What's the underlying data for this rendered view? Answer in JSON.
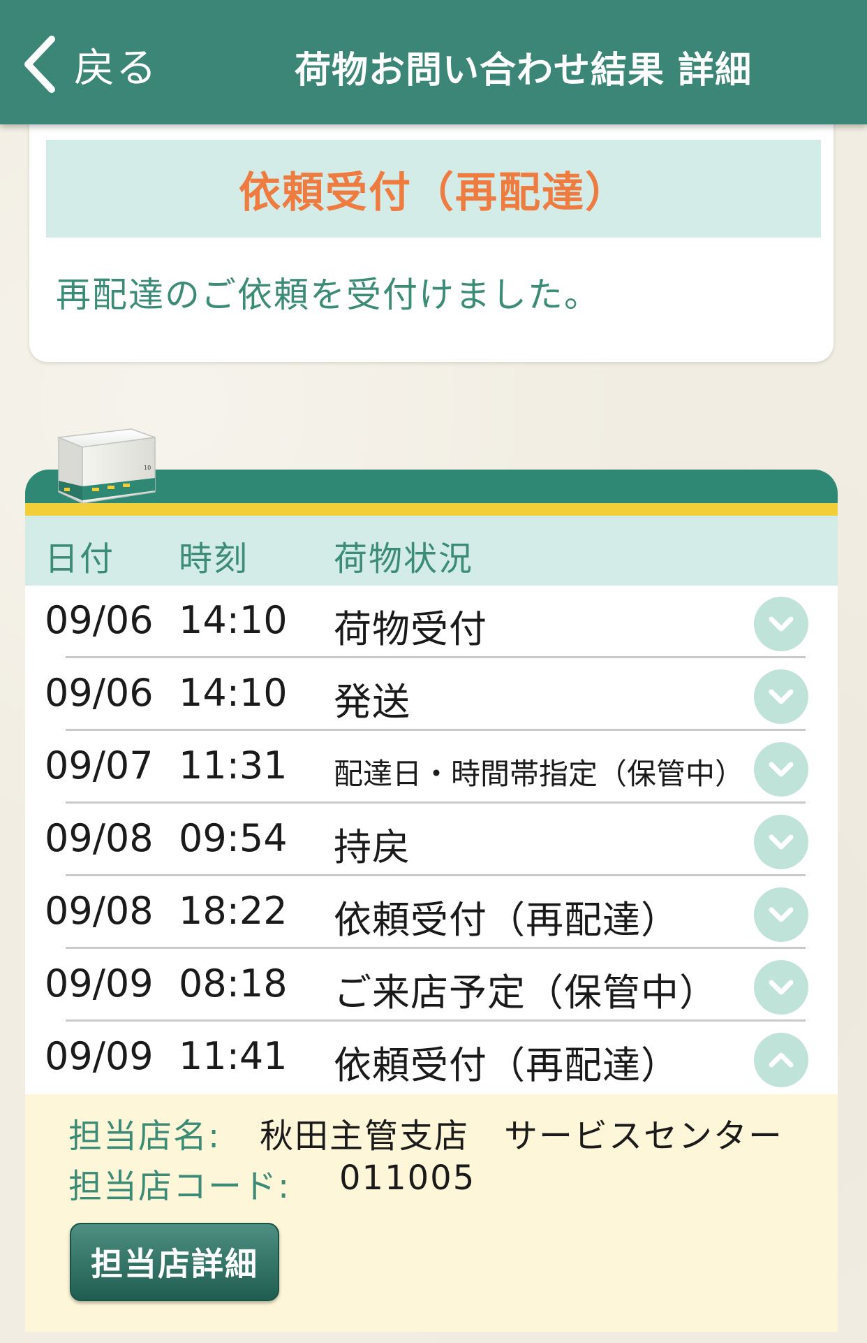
{
  "header": {
    "back_label": "戻る",
    "title": "荷物お問い合わせ結果 詳細"
  },
  "status_card": {
    "title": "依頼受付（再配達）",
    "message": "再配達のご依頼を受付けました。"
  },
  "tracking": {
    "columns": {
      "date": "日付",
      "time": "時刻",
      "status": "荷物状況"
    },
    "rows": [
      {
        "date": "09/06",
        "time": "14:10",
        "status": "荷物受付",
        "expanded": false
      },
      {
        "date": "09/06",
        "time": "14:10",
        "status": "発送",
        "expanded": false
      },
      {
        "date": "09/07",
        "time": "11:31",
        "status": "配達日・時間帯指定（保管中）",
        "expanded": false
      },
      {
        "date": "09/08",
        "time": "09:54",
        "status": "持戻",
        "expanded": false
      },
      {
        "date": "09/08",
        "time": "18:22",
        "status": "依頼受付（再配達）",
        "expanded": false
      },
      {
        "date": "09/09",
        "time": "08:18",
        "status": "ご来店予定（保管中）",
        "expanded": false
      },
      {
        "date": "09/09",
        "time": "11:41",
        "status": "依頼受付（再配達）",
        "expanded": true
      }
    ],
    "detail": {
      "store_name_label": "担当店名:",
      "store_name": "秋田主管支店　サービスセンター",
      "store_code_label": "担当店コード:",
      "store_code": "011005",
      "store_detail_button": "担当店詳細"
    }
  },
  "colors": {
    "header_bg": "#3b8676",
    "accent_orange": "#ee7b3f",
    "accent_green_text": "#3b8b77",
    "banner_bg": "#d3ece7",
    "stripe_yellow": "#f2cf39",
    "detail_bg": "#fdf6d8"
  },
  "icons": {
    "back": "chevron-left-icon",
    "collapsed": "chevron-down-icon",
    "expanded": "chevron-up-icon",
    "package": "package-box-icon"
  }
}
